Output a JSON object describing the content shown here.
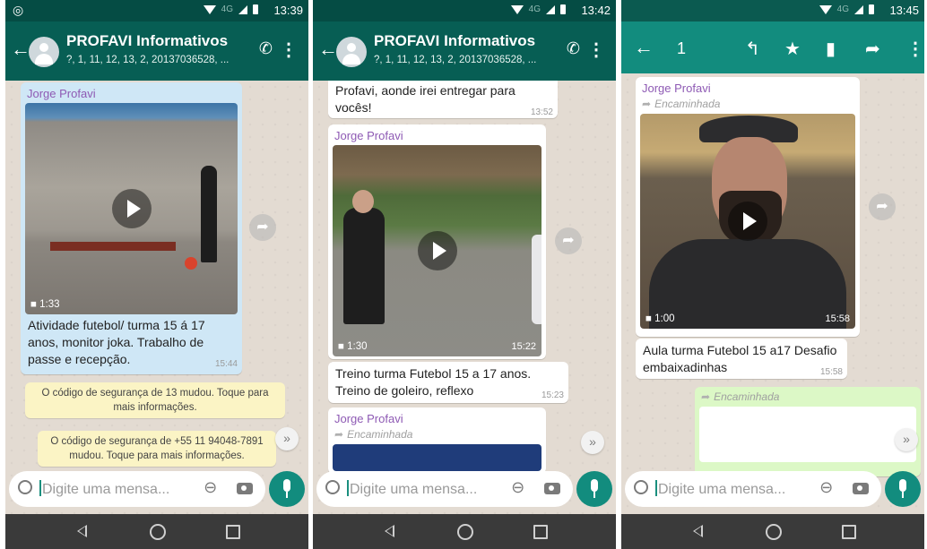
{
  "screens": [
    {
      "status_time": "13:39",
      "chat_title": "PROFAVI Informativos",
      "chat_subtitle": "?, 1, 11, 12, 13, 2, 20137036528, ...",
      "top_text": "",
      "top_time": "",
      "sender": "Jorge Profavi",
      "video_duration": "1:33",
      "video_time": "",
      "caption": "Atividade futebol/ turma 15 á 17 anos,  monitor joka. Trabalho de passe e recepção.",
      "caption_time": "15:44",
      "system_messages": [
        "O código de segurança de 13 mudou. Toque para mais informações.",
        "O código de segurança de +55 11 94048-7891 mudou. Toque para mais informações."
      ],
      "input_placeholder": "Digite uma mensa..."
    },
    {
      "status_time": "13:42",
      "chat_title": "PROFAVI Informativos",
      "chat_subtitle": "?, 1, 11, 12, 13, 2, 20137036528, ...",
      "top_text": "Profavi, aonde irei entregar para vocês!",
      "top_time": "13:52",
      "sender": "Jorge Profavi",
      "video_duration": "1:30",
      "video_time": "15:22",
      "caption": "Treino turma Futebol 15 a 17 anos. Treino de goleiro, reflexo",
      "caption_time": "15:23",
      "next_sender": "Jorge Profavi",
      "next_forwarded": "Encaminhada",
      "input_placeholder": "Digite uma mensa..."
    },
    {
      "status_time": "13:45",
      "selection_count": "1",
      "sender": "Jorge Profavi",
      "forwarded": "Encaminhada",
      "video_duration": "1:00",
      "video_time": "15:58",
      "caption": "Aula turma Futebol 15 a17 Desafio embaixadinhas",
      "caption_time": "15:58",
      "next_forwarded": "Encaminhada",
      "input_placeholder": "Digite uma mensa..."
    }
  ],
  "colors": {
    "appbar": "#075e54",
    "statusbar": "#054c44",
    "sender": "#8e5ab4",
    "mic": "#128c7e",
    "system": "#fbf4c5",
    "selected": "#cfe7f6"
  }
}
